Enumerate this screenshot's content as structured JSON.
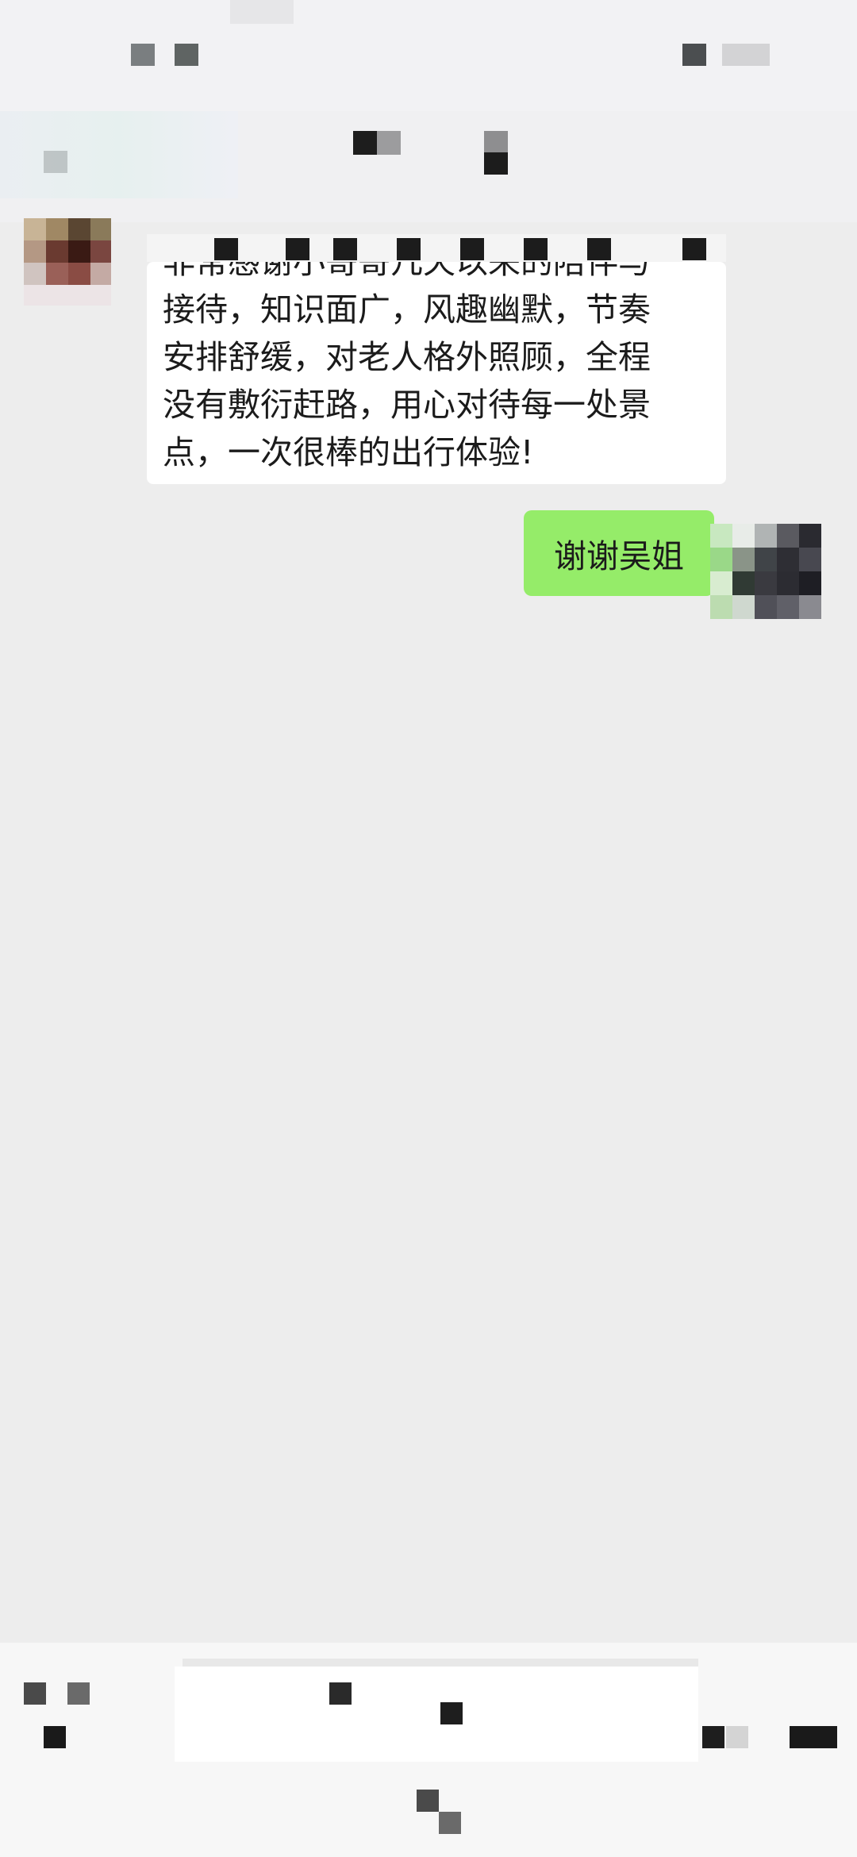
{
  "chat": {
    "incoming_partial": "非常感谢小哥哥几天以来的陪伴与",
    "incoming_lines": [
      "接待，知识面广，风趣幽默，节奏",
      "安排舒缓，对老人格外照顾，全程",
      "没有敷衍赶路，用心对待每一处景",
      "点，一次很棒的出行体验!"
    ],
    "outgoing_text": "谢谢吴姐"
  },
  "colors": {
    "background": "#ededed",
    "incoming_bubble": "#ffffff",
    "outgoing_bubble": "#95ec69"
  }
}
